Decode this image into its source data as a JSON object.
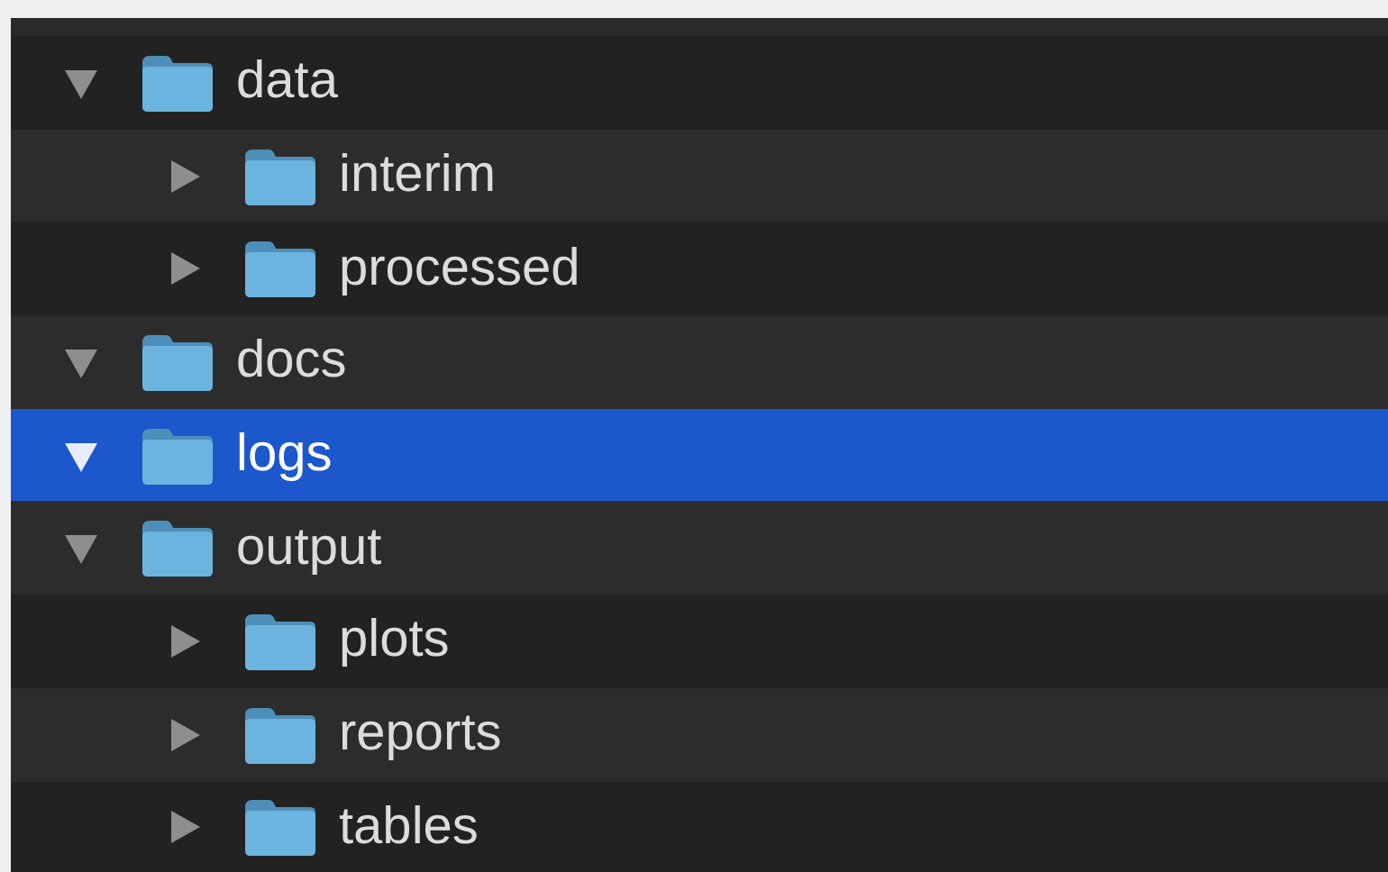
{
  "tree": [
    {
      "label": "data",
      "expanded": true,
      "selected": false,
      "children": [
        {
          "label": "interim",
          "expanded": false,
          "selected": false
        },
        {
          "label": "processed",
          "expanded": false,
          "selected": false
        }
      ]
    },
    {
      "label": "docs",
      "expanded": true,
      "selected": false
    },
    {
      "label": "logs",
      "expanded": true,
      "selected": true
    },
    {
      "label": "output",
      "expanded": true,
      "selected": false,
      "children": [
        {
          "label": "plots",
          "expanded": false,
          "selected": false
        },
        {
          "label": "reports",
          "expanded": false,
          "selected": false
        },
        {
          "label": "tables",
          "expanded": false,
          "selected": false
        }
      ]
    }
  ]
}
